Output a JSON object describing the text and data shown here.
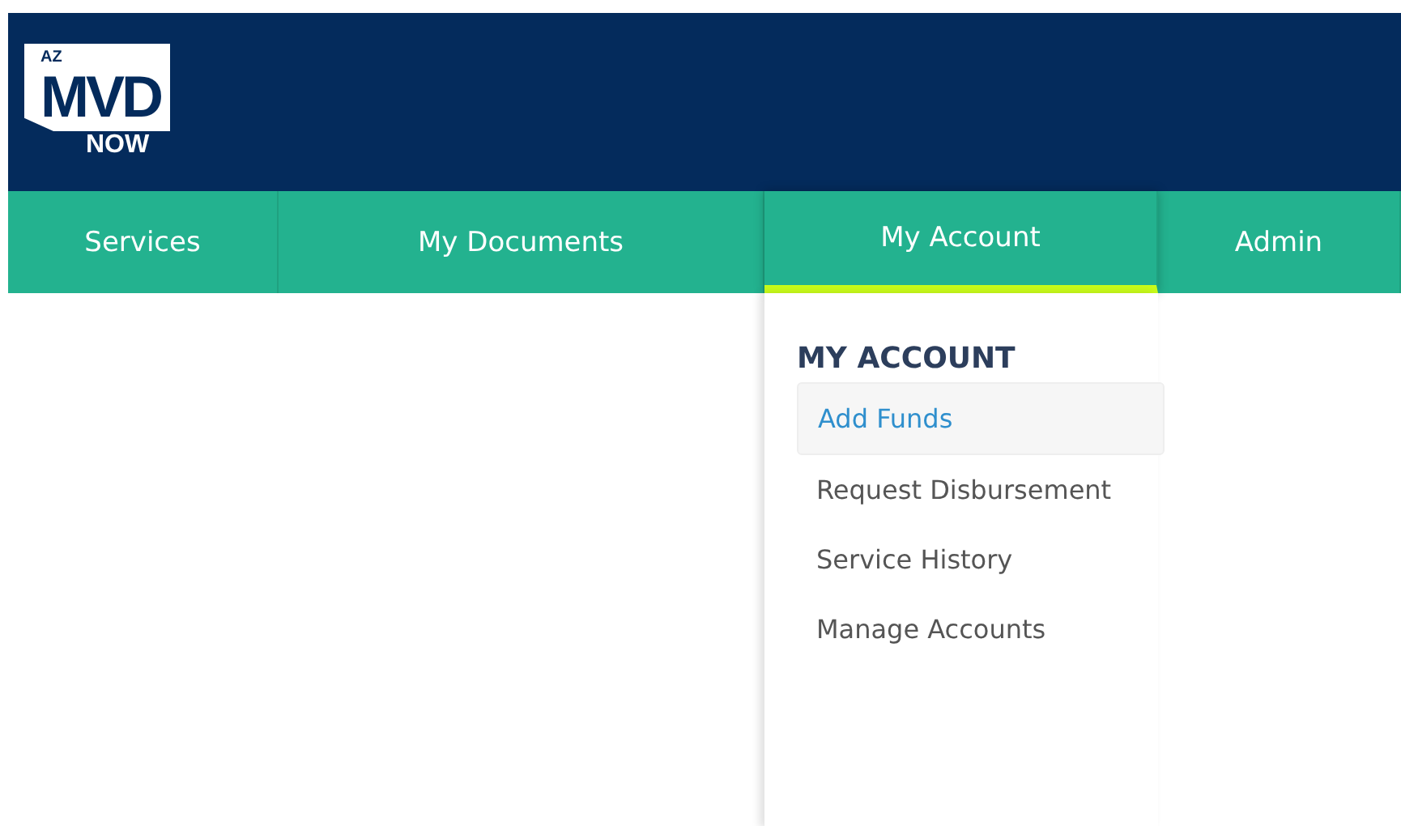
{
  "logo": {
    "state": "AZ",
    "name": "MVD",
    "sub": "NOW"
  },
  "nav": [
    {
      "label": "Services",
      "selected": false
    },
    {
      "label": "My Documents",
      "selected": false
    },
    {
      "label": "My Account",
      "selected": true
    },
    {
      "label": "Admin",
      "selected": false
    }
  ],
  "dropdown": {
    "heading": "MY ACCOUNT",
    "items": [
      {
        "label": "Add Funds",
        "selected": true
      },
      {
        "label": "Request Disbursement",
        "selected": false
      },
      {
        "label": "Service History",
        "selected": false
      },
      {
        "label": "Manage Accounts",
        "selected": false
      }
    ]
  }
}
